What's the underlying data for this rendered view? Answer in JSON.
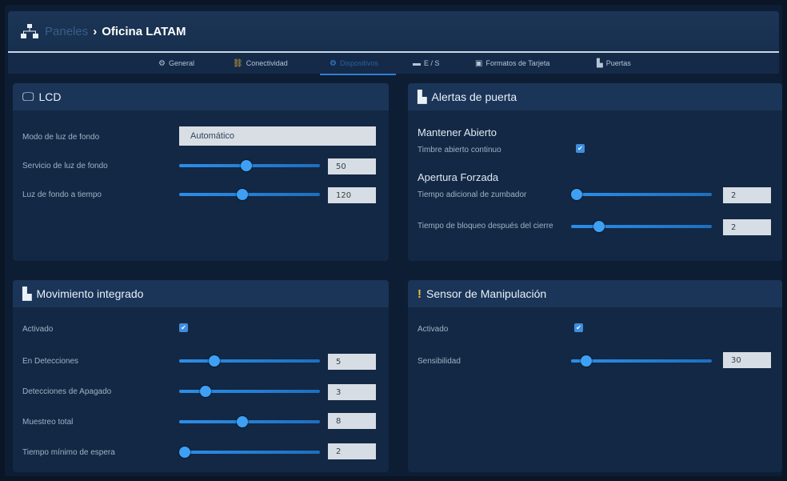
{
  "header": {
    "breadcrumb_parent": "Paneles",
    "separator": "›",
    "title": "Oficina LATAM"
  },
  "tabs": [
    {
      "label": "General",
      "icon": "gear-icon"
    },
    {
      "label": "Conectividad",
      "icon": "network-icon"
    },
    {
      "label": "Dispositivos",
      "icon": "cogs-icon",
      "active": true
    },
    {
      "label": "E / S",
      "icon": "io-icon"
    },
    {
      "label": "Formatos de Tarjeta",
      "icon": "card-icon"
    },
    {
      "label": "Puertas",
      "icon": "door-icon"
    }
  ],
  "lcd": {
    "title": "LCD",
    "backlight_mode_label": "Modo de luz de fondo",
    "backlight_mode_value": "Automático",
    "backlight_duty_label": "Servicio de luz de fondo",
    "backlight_duty_value": "50",
    "backlight_duty_fraction": 0.48,
    "backlight_timeout_label": "Luz de fondo a tiempo",
    "backlight_timeout_value": "120",
    "backlight_timeout_fraction": 0.45
  },
  "door_alerts": {
    "title": "Alertas de puerta",
    "held_open_heading": "Mantener Abierto",
    "continuous_buzzer_label": "Timbre abierto continuo",
    "continuous_buzzer_checked": true,
    "forced_heading": "Apertura Forzada",
    "extra_buzzer_label": "Tiempo adicional de zumbador",
    "extra_buzzer_value": "2",
    "extra_buzzer_fraction": 0.0,
    "lock_time_label": "Tiempo de bloqueo después del cierre",
    "lock_time_value": "2",
    "lock_time_fraction": 0.2
  },
  "motion": {
    "title": "Movimiento integrado",
    "enabled_label": "Activado",
    "enabled_checked": true,
    "on_detections_label": "En Detecciones",
    "on_detections_value": "5",
    "on_detections_fraction": 0.25,
    "off_detections_label": "Detecciones de Apagado",
    "off_detections_value": "3",
    "off_detections_fraction": 0.19,
    "total_sampling_label": "Muestreo total",
    "total_sampling_value": "8",
    "total_sampling_fraction": 0.45,
    "min_wait_label": "Tiempo mínimo de espera",
    "min_wait_value": "2",
    "min_wait_fraction": 0.0
  },
  "tamper": {
    "title": "Sensor de Manipulación",
    "enabled_label": "Activado",
    "enabled_checked": true,
    "sensitivity_label": "Sensibilidad",
    "sensitivity_value": "30",
    "sensitivity_fraction": 0.11
  },
  "colors": {
    "accent": "#2f7fd1",
    "panel": "#132844",
    "panel_header": "#1b3558"
  }
}
